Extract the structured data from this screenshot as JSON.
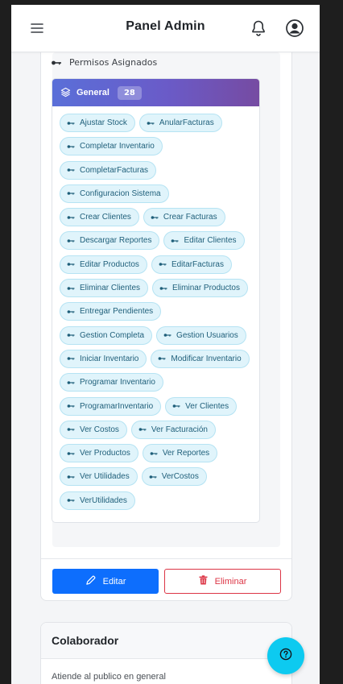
{
  "header": {
    "title": "Panel Admin",
    "menu_icon": "hamburger-menu-icon",
    "notifications_icon": "bell-icon",
    "profile_icon": "user-circle-icon"
  },
  "permissions": {
    "section_label": "Permisos Asignados",
    "group": {
      "name": "General",
      "count": "28",
      "icon": "layers-icon"
    },
    "items": [
      "Ajustar Stock",
      "AnularFacturas",
      "Completar Inventario",
      "CompletarFacturas",
      "Configuracion Sistema",
      "Crear Clientes",
      "Crear Facturas",
      "Descargar Reportes",
      "Editar Clientes",
      "Editar Productos",
      "EditarFacturas",
      "Eliminar Clientes",
      "Eliminar Productos",
      "Entregar Pendientes",
      "Gestion Completa",
      "Gestion Usuarios",
      "Iniciar Inventario",
      "Modificar Inventario",
      "Programar Inventario",
      "ProgramarInventario",
      "Ver Clientes",
      "Ver Costos",
      "Ver Facturación",
      "Ver Productos",
      "Ver Reportes",
      "Ver Utilidades",
      "VerCostos",
      "VerUtilidades"
    ]
  },
  "actions": {
    "edit_label": "Editar",
    "delete_label": "Eliminar"
  },
  "next_role": {
    "title": "Colaborador",
    "description": "Atiende al publico en general"
  },
  "help": {
    "icon": "question-circle-icon"
  },
  "colors": {
    "primary": "#0d6efd",
    "danger": "#dc3545",
    "chip_bg": "#e0f4fb",
    "chip_text": "#1f5f7a",
    "group_gradient_start": "#5a6fd8",
    "group_gradient_end": "#764ba2",
    "fab": "#0dcaf0"
  }
}
